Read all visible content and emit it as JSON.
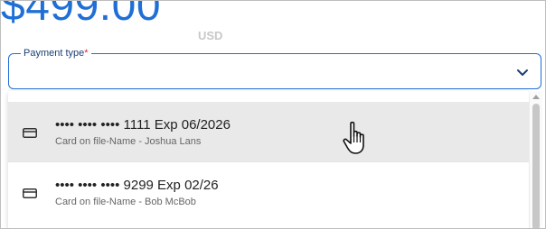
{
  "price": {
    "amount": "$499.00",
    "currency": "USD"
  },
  "payment_select": {
    "label": "Payment type",
    "required_mark": "*",
    "value": ""
  },
  "options": [
    {
      "title": "•••• •••• •••• 1111 Exp 06/2026",
      "subtitle": "Card on file-Name - Joshua Lans",
      "icon": "credit-card-icon",
      "hovered": true
    },
    {
      "title": "•••• •••• •••• 9299 Exp 02/26",
      "subtitle": "Card on file-Name - Bob McBob",
      "icon": "credit-card-icon",
      "hovered": false
    }
  ],
  "colors": {
    "accent": "#1f6fd6",
    "required": "#d32f2f",
    "hover_bg": "#e9e9e9"
  }
}
